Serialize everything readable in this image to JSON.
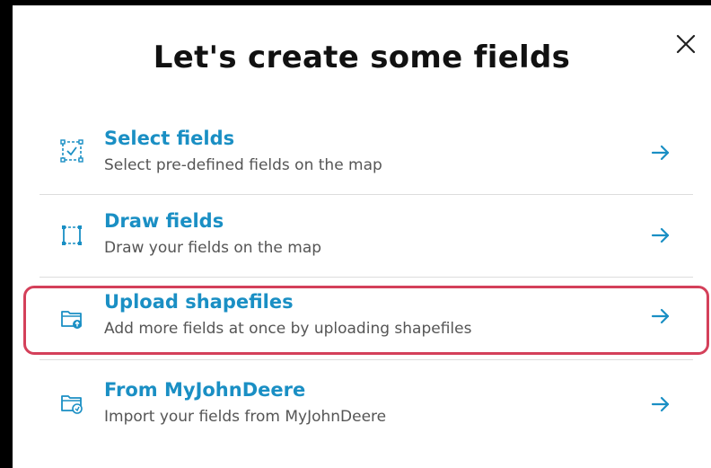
{
  "dialog": {
    "title": "Let's create some fields",
    "close_icon": "close-icon"
  },
  "options": [
    {
      "title": "Select fields",
      "subtitle": "Select pre-defined fields on the map",
      "icon": "select-area-icon"
    },
    {
      "title": "Draw fields",
      "subtitle": "Draw your fields on the map",
      "icon": "draw-area-icon"
    },
    {
      "title": "Upload shapefiles",
      "subtitle": "Add more fields at once by uploading shapefiles",
      "icon": "folder-upload-icon"
    },
    {
      "title": "From MyJohnDeere",
      "subtitle": "Import your fields from MyJohnDeere",
      "icon": "folder-import-icon"
    }
  ],
  "colors": {
    "accent": "#1a8fc4",
    "highlight": "#d4405a",
    "title": "#111111",
    "subtitle": "#555555"
  }
}
